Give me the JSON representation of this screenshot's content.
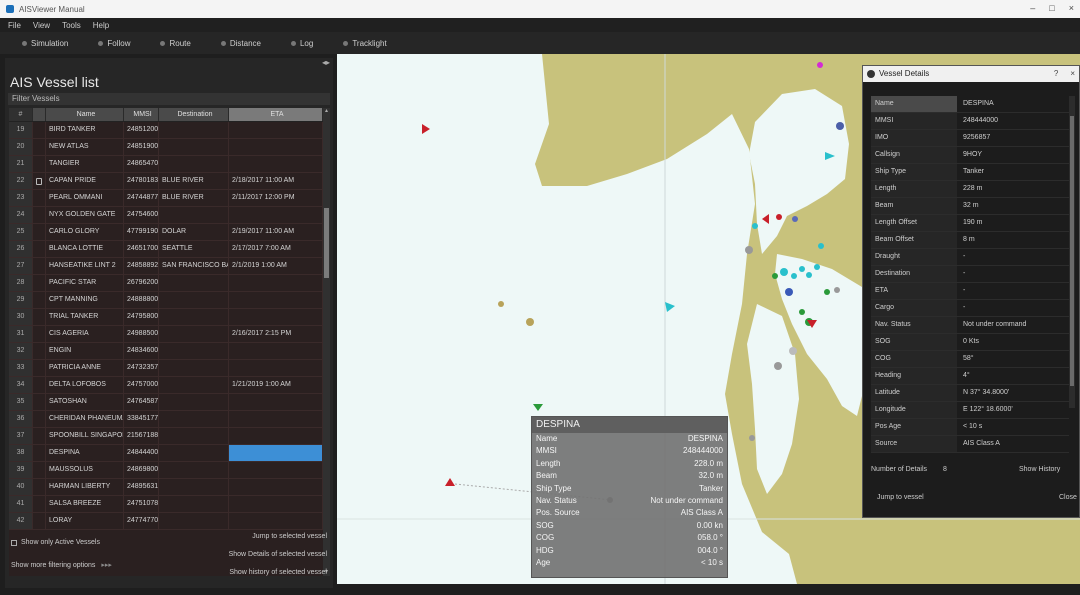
{
  "window": {
    "title": "AISViewer Manual",
    "buttons": [
      "–",
      "□",
      "×"
    ]
  },
  "menu": [
    "File",
    "View",
    "Tools",
    "Help"
  ],
  "toolbar": [
    "Simulation",
    "Follow",
    "Route",
    "Distance",
    "Log",
    "Tracklight"
  ],
  "vessel_list": {
    "title": "AIS Vessel list",
    "filter_label": "Filter Vessels",
    "columns": [
      "#",
      "",
      "Name",
      "MMSI",
      "Destination",
      "ETA"
    ],
    "rows": [
      {
        "n": "19",
        "name": "BIRD TANKER",
        "mmsi": "248512000",
        "dest": "",
        "eta": ""
      },
      {
        "n": "20",
        "name": "NEW ATLAS",
        "mmsi": "248519000",
        "dest": "",
        "eta": ""
      },
      {
        "n": "21",
        "name": "TANGIER",
        "mmsi": "248654700",
        "dest": "",
        "eta": ""
      },
      {
        "n": "22",
        "name": "CAPAN PRIDE",
        "mmsi": "247801830",
        "dest": "BLUE RIVER",
        "eta": "2/18/2017 11:00 AM"
      },
      {
        "n": "23",
        "name": "PEARL OMMANI",
        "mmsi": "247448770",
        "dest": "BLUE RIVER",
        "eta": "2/11/2017 12:00 PM"
      },
      {
        "n": "24",
        "name": "NYX GOLDEN GATE",
        "mmsi": "247546000",
        "dest": "",
        "eta": ""
      },
      {
        "n": "25",
        "name": "CARLO GLORY",
        "mmsi": "477991900",
        "dest": "DOLAR",
        "eta": "2/19/2017 11:00 AM"
      },
      {
        "n": "26",
        "name": "BLANCA LOTTIE",
        "mmsi": "246517000",
        "dest": "SEATTLE",
        "eta": "2/17/2017 7:00 AM"
      },
      {
        "n": "27",
        "name": "HANSEATIKE LINT 2",
        "mmsi": "248588920",
        "dest": "SAN FRANCISCO BAY",
        "eta": "2/1/2019 1:00 AM"
      },
      {
        "n": "28",
        "name": "PACIFIC STAR",
        "mmsi": "267962000",
        "dest": "",
        "eta": ""
      },
      {
        "n": "29",
        "name": "CPT MANNING",
        "mmsi": "248888000",
        "dest": "",
        "eta": ""
      },
      {
        "n": "30",
        "name": "TRIAL TANKER",
        "mmsi": "247958000",
        "dest": "",
        "eta": ""
      },
      {
        "n": "31",
        "name": "CIS AGERIA",
        "mmsi": "249885000",
        "dest": "",
        "eta": "2/16/2017 2:15 PM"
      },
      {
        "n": "32",
        "name": "ENGIN",
        "mmsi": "248346000",
        "dest": "",
        "eta": ""
      },
      {
        "n": "33",
        "name": "PATRICIA ANNE",
        "mmsi": "247323570",
        "dest": "",
        "eta": ""
      },
      {
        "n": "34",
        "name": "DELTA LOFOBOS",
        "mmsi": "247570000",
        "dest": "",
        "eta": "1/21/2019 1:00 AM"
      },
      {
        "n": "35",
        "name": "SATOSHAN",
        "mmsi": "247645870",
        "dest": "",
        "eta": ""
      },
      {
        "n": "36",
        "name": "CHERIDAN PHANEUMAN",
        "mmsi": "338451770",
        "dest": "",
        "eta": ""
      },
      {
        "n": "37",
        "name": "SPOONBILL SINGAPORE",
        "mmsi": "215671880",
        "dest": "",
        "eta": ""
      },
      {
        "n": "38",
        "name": "DESPINA",
        "mmsi": "248444000",
        "dest": "",
        "eta": "",
        "selected": true
      },
      {
        "n": "39",
        "name": "MAUSSOLUS",
        "mmsi": "248698000",
        "dest": "",
        "eta": ""
      },
      {
        "n": "40",
        "name": "HARMAN LIBERTY",
        "mmsi": "248956310",
        "dest": "",
        "eta": ""
      },
      {
        "n": "41",
        "name": "SALSA BREEZE",
        "mmsi": "247510780",
        "dest": "",
        "eta": ""
      },
      {
        "n": "42",
        "name": "LORAY",
        "mmsi": "247747700",
        "dest": "",
        "eta": ""
      }
    ],
    "show_active_only": "Show only Active Vessels",
    "filter_options": "Show more filtering options",
    "filter_options_arrow": "▸▸▸",
    "buttons": [
      "Jump to selected vessel",
      "Show Details of selected vessel",
      "Show history of selected vessel"
    ]
  },
  "popup": {
    "title": "DESPINA",
    "rows": [
      {
        "k": "Name",
        "v": "DESPINA"
      },
      {
        "k": "MMSI",
        "v": "248444000"
      },
      {
        "k": "Length",
        "v": "228.0 m"
      },
      {
        "k": "Beam",
        "v": "32.0 m"
      },
      {
        "k": "Ship Type",
        "v": "Tanker"
      },
      {
        "k": "Nav. Status",
        "v": "Not under command"
      },
      {
        "k": "Pos. Source",
        "v": "AIS Class A"
      },
      {
        "k": "SOG",
        "v": "0.00 kn"
      },
      {
        "k": "COG",
        "v": "058.0 °"
      },
      {
        "k": "HDG",
        "v": "004.0 °"
      },
      {
        "k": "Age",
        "v": "< 10 s"
      }
    ]
  },
  "vessel_details": {
    "title": "Vessel Details",
    "rows": [
      {
        "k": "Name",
        "v": "DESPINA"
      },
      {
        "k": "MMSI",
        "v": "248444000"
      },
      {
        "k": "IMO",
        "v": "9256857"
      },
      {
        "k": "Callsign",
        "v": "9HOY"
      },
      {
        "k": "Ship Type",
        "v": "Tanker"
      },
      {
        "k": "Length",
        "v": "228 m"
      },
      {
        "k": "Beam",
        "v": "32 m"
      },
      {
        "k": "Length Offset",
        "v": "190 m"
      },
      {
        "k": "Beam Offset",
        "v": "8 m"
      },
      {
        "k": "Draught",
        "v": "-"
      },
      {
        "k": "Destination",
        "v": "-"
      },
      {
        "k": "ETA",
        "v": "-"
      },
      {
        "k": "Cargo",
        "v": "-"
      },
      {
        "k": "Nav. Status",
        "v": "Not under command"
      },
      {
        "k": "SOG",
        "v": "0 Kts"
      },
      {
        "k": "COG",
        "v": "58°"
      },
      {
        "k": "Heading",
        "v": "4°"
      },
      {
        "k": "Latitude",
        "v": "N 37° 34.8000'"
      },
      {
        "k": "Longitude",
        "v": "E 122° 18.6000'"
      },
      {
        "k": "Pos Age",
        "v": "< 10 s"
      },
      {
        "k": "Source",
        "v": "AIS Class A"
      }
    ],
    "number_of_details_label": "Number of Details",
    "number_of_details_value": "8",
    "buttons": {
      "show_history": "Show History",
      "jump": "Jump to vessel",
      "close": "Close"
    }
  },
  "colors": {
    "land": "#c8c27c",
    "water": "#eef8f7",
    "selection": "#3d8fd6"
  }
}
